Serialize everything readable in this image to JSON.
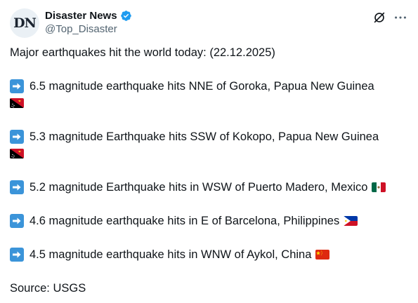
{
  "account": {
    "avatar_text": "DN",
    "display_name": "Disaster News",
    "handle": "@Top_Disaster"
  },
  "post": {
    "intro": "Major earthquakes hit the world today: (22.12.2025)",
    "items": [
      {
        "text": "6.5 magnitude earthquake hits NNE of Goroka, Papua New Guinea",
        "flag": "papua-new-guinea-flag"
      },
      {
        "text": "5.3 magnitude Earthquake hits SSW of Kokopo, Papua New Guinea",
        "flag": "papua-new-guinea-flag"
      },
      {
        "text": "5.2 magnitude Earthquake hits in WSW of Puerto Madero, Mexico",
        "flag": "mexico-flag"
      },
      {
        "text": "4.6 magnitude earthquake hits in E of Barcelona, Philippines",
        "flag": "philippines-flag"
      },
      {
        "text": "4.5 magnitude earthquake hits in WNW of Aykol, China",
        "flag": "china-flag"
      }
    ],
    "source": "Source: USGS"
  },
  "icons": {
    "verified": "verified-badge-icon",
    "grok": "grok-icon",
    "more": "more-options-icon",
    "arrow": "right-arrow-icon"
  },
  "colors": {
    "verified": "#1d9bf0",
    "arrow_bg": "#3b94d9",
    "handle": "#536471"
  }
}
